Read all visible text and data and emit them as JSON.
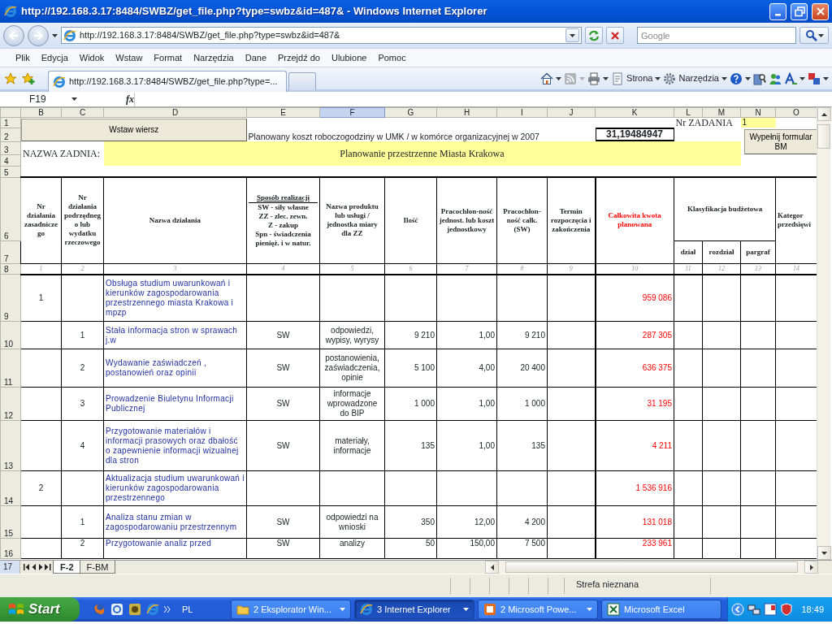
{
  "window": {
    "title": "http://192.168.3.17:8484/SWBZ/get_file.php?type=swbz&id=487& - Windows Internet Explorer"
  },
  "address_bar": {
    "url": "http://192.168.3.17:8484/SWBZ/get_file.php?type=swbz&id=487&",
    "search_placeholder": "Google"
  },
  "menu": [
    "Plik",
    "Edycja",
    "Widok",
    "Wstaw",
    "Format",
    "Narzędzia",
    "Dane",
    "Przejdź do",
    "Ulubione",
    "Pomoc"
  ],
  "tabs": [
    {
      "label": "http://192.168.3.17:8484/SWBZ/get_file.php?type=...",
      "selected": true
    }
  ],
  "command_bar": [
    "Strona",
    "Narzędzia"
  ],
  "spreadsheet": {
    "name_box": "F19",
    "formula_label": "fx",
    "columns": [
      {
        "label": "B",
        "selected": false
      },
      {
        "label": "C",
        "selected": false
      },
      {
        "label": "D",
        "selected": false
      },
      {
        "label": "E",
        "selected": false
      },
      {
        "label": "F",
        "selected": true
      },
      {
        "label": "G",
        "selected": false
      },
      {
        "label": "H",
        "selected": false
      },
      {
        "label": "I",
        "selected": false
      },
      {
        "label": "J",
        "selected": false
      },
      {
        "label": "K",
        "selected": false
      },
      {
        "label": "L",
        "selected": false
      },
      {
        "label": "M",
        "selected": false
      },
      {
        "label": "N",
        "selected": false
      },
      {
        "label": "O",
        "selected": false
      }
    ],
    "row_headers": [
      "1",
      "2",
      "3",
      "4",
      "5",
      "6",
      "7",
      "8",
      "9",
      "10",
      "11",
      "12",
      "13",
      "14",
      "15",
      "16"
    ],
    "insert_row_button": "Wstaw wiersz",
    "hourly_cost_label": "Planowany koszt roboczogodziny w UMK / w komórce organizacyjnej w 2007",
    "hourly_cost_value": "31,19484947",
    "task_number_label": "Nr ZADANIA",
    "task_number": "1",
    "fill_form_button": [
      "Wypełnij formular",
      "BM"
    ],
    "task_name_label": "NAZWA ZADNIA:",
    "task_name": "Planowanie przestrzenne Miasta Krakowa",
    "header": {
      "b": "Nr działania zasadniczego",
      "c": "Nr działania podrzędnego lub wydatku rzeczowego",
      "d": "Nazwa działania",
      "e_title": "Sposób realizacji",
      "e_lines": [
        "SW - siły własne",
        "ZZ - zlec. zewn.",
        "Z -  zakup",
        "Spn - świadczenia",
        "pienięż. i w natur."
      ],
      "f": "Nazwa produktu lub usługi / jednostka miary dla ZZ",
      "g": "Ilość",
      "h": "Pracochłon-ność jednost. lub koszt jednostkowy",
      "i": "Pracochłon-ność całk. (SW)",
      "j": "Termin rozpoczęcia i zakończenia",
      "k": "Całkowita kwota planowana",
      "budget": "Klasyfikacja budżetowa",
      "budget_sub": [
        "dział",
        "rozdział",
        "pargraf"
      ],
      "o_lines": [
        "Kategor",
        "przedsięwi"
      ]
    },
    "column_numbers": [
      "1",
      "2",
      "3",
      "4",
      "5",
      "6",
      "7",
      "8",
      "9",
      "10",
      "11",
      "12",
      "13",
      "14"
    ],
    "rows": [
      {
        "b": "1",
        "d": "Obsługa studium uwarunkowań i kierunków zagospodarowania przestrzennego miasta Krakowa i mpzp",
        "k": "959 086"
      },
      {
        "c": "1",
        "d": "Stała informacja stron w sprawach j.w",
        "e": "SW",
        "f": "odpowiedzi, wypisy, wyrysy",
        "g": "9 210",
        "h": "1,00",
        "i": "9 210",
        "k": "287 305"
      },
      {
        "c": "2",
        "d": "Wydawanie zaświadczeń , postanowień oraz opinii",
        "e": "SW",
        "f": "postanowienia, zaświadczenia, opinie",
        "g": "5 100",
        "h": "4,00",
        "i": "20 400",
        "k": "636 375"
      },
      {
        "c": "3",
        "d": "Prowadzenie Biuletynu Informacji Publicznej",
        "e": "SW",
        "f": "informacje wprowadzone do BIP",
        "g": "1 000",
        "h": "1,00",
        "i": "1 000",
        "k": "31 195"
      },
      {
        "c": "4",
        "d": "Przygotowanie materiałów i informacji prasowych oraz dbałość o zapewnienie informacji wizualnej dla stron",
        "e": "SW",
        "f": "materiały, informacje",
        "g": "135",
        "h": "1,00",
        "i": "135",
        "k": "4 211"
      },
      {
        "b": "2",
        "d": "Aktualizacja studium uwarunkowań i kierunków zagospodarowania przestrzennego",
        "k": "1 536 916"
      },
      {
        "c": "1",
        "d": "Analiza stanu zmian w zagospodarowaniu przestrzennym",
        "e": "SW",
        "f": "odpowiedzi na wnioski",
        "g": "350",
        "h": "12,00",
        "i": "4 200",
        "k": "131 018"
      },
      {
        "c": "2",
        "d": "Przygotowanie analiz przed",
        "e": "SW",
        "f": "analizy",
        "g": "50",
        "h": "150,00",
        "i": "7 500",
        "k": "233 961"
      }
    ]
  },
  "sheet_bar": {
    "row_header": "17",
    "tabs": [
      {
        "label": "F-2",
        "selected": true
      },
      {
        "label": "F-BM",
        "selected": false
      }
    ]
  },
  "status_bar": {
    "zone": "Strefa nieznana"
  },
  "taskbar": {
    "start": "Start",
    "language": "PL",
    "tasks": [
      {
        "label": "2 Eksplorator Win...",
        "selected": false,
        "kind": "folder"
      },
      {
        "label": "3 Internet Explorer",
        "selected": true,
        "kind": "browser"
      },
      {
        "label": "2 Microsoft Powe...",
        "selected": false,
        "kind": "slides"
      },
      {
        "label": "Microsoft Excel",
        "selected": false,
        "kind": "sheet"
      }
    ],
    "clock": "18:49"
  }
}
